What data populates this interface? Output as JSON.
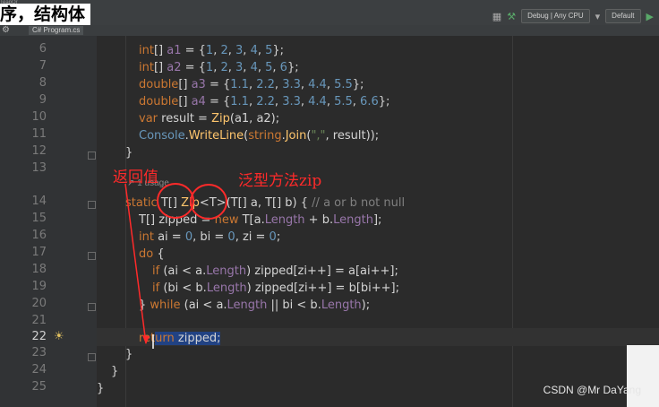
{
  "overlay_title": "序，结构体",
  "tab": {
    "label": "C# Program.cs"
  },
  "toolbar": {
    "config": "Debug | Any CPU",
    "platform": "Default"
  },
  "code_lines": [
    {
      "n": "6",
      "text": "int[] a1 = {1, 2, 3, 4, 5};"
    },
    {
      "n": "7",
      "text": "int[] a2 = {1, 2, 3, 4, 5, 6};"
    },
    {
      "n": "8",
      "text": "double[] a3 = {1.1, 2.2, 3.3, 4.4, 5.5};"
    },
    {
      "n": "9",
      "text": "double[] a4 = {1.1, 2.2, 3.3, 4.4, 5.5, 6.6};"
    },
    {
      "n": "10",
      "text": "var result = Zip(a1, a2);"
    },
    {
      "n": "11",
      "text": "Console.WriteLine(string.Join(\",\", result));"
    },
    {
      "n": "12",
      "text": "}"
    },
    {
      "n": "13",
      "text": ""
    },
    {
      "n": "14",
      "text": "static T[] Zip<T>(T[] a, T[] b) { // a or b not null"
    },
    {
      "n": "15",
      "text": "T[] zipped = new T[a.Length + b.Length];"
    },
    {
      "n": "16",
      "text": "int ai = 0, bi = 0, zi = 0;"
    },
    {
      "n": "17",
      "text": "do {"
    },
    {
      "n": "18",
      "text": "if (ai < a.Length) zipped[zi++] = a[ai++];"
    },
    {
      "n": "19",
      "text": "if (bi < b.Length) zipped[zi++] = b[bi++];"
    },
    {
      "n": "20",
      "text": "} while (ai < a.Length || bi < b.Length);"
    },
    {
      "n": "21",
      "text": ""
    },
    {
      "n": "22",
      "text": "return zipped;"
    },
    {
      "n": "23",
      "text": "}"
    },
    {
      "n": "24",
      "text": "}"
    },
    {
      "n": "25",
      "text": "}"
    }
  ],
  "usage_hint": "1 usage",
  "annotations": {
    "left": "返回值",
    "right": "泛型方法zip"
  },
  "watermark": "CSDN @Mr DaYang",
  "colors": {
    "annotation": "#ff2a2a",
    "selection": "#214283"
  }
}
